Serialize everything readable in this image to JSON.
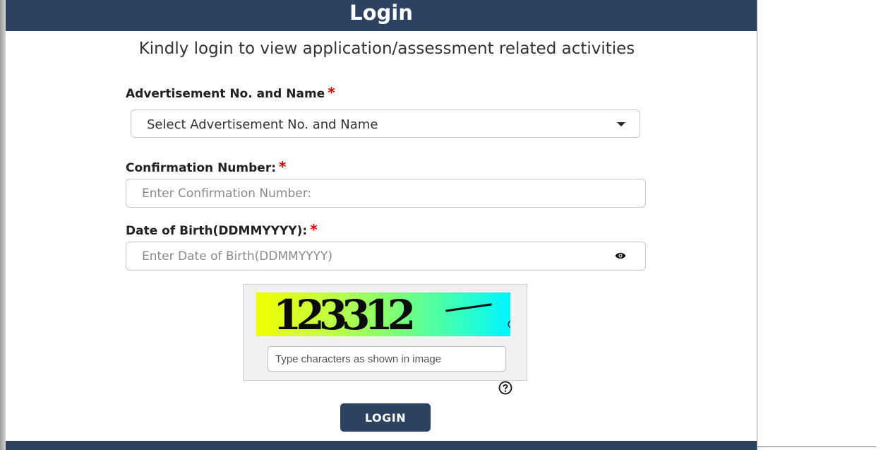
{
  "header": {
    "title": "Login"
  },
  "intro": "Kindly login to view application/assessment related activities",
  "form": {
    "advertisement": {
      "label": "Advertisement No. and Name",
      "required_mark": "*",
      "selected": "Select Advertisement No. and Name"
    },
    "confirmation": {
      "label": "Confirmation Number:",
      "required_mark": "*",
      "placeholder": "Enter Confirmation Number:",
      "value": ""
    },
    "dob": {
      "label": "Date of Birth(DDMMYYYY):",
      "required_mark": "*",
      "placeholder": "Enter Date of Birth(DDMMYYYY)",
      "value": "",
      "toggle_icon": "eye-icon"
    },
    "captcha": {
      "image_text": "123312",
      "placeholder": "Type characters as shown in image",
      "value": "",
      "refresh_icon": "refresh-icon",
      "help_icon": "question-circle-icon"
    },
    "submit_label": "LOGIN"
  },
  "colors": {
    "brand": "#2d4260",
    "required": "#e00000"
  }
}
